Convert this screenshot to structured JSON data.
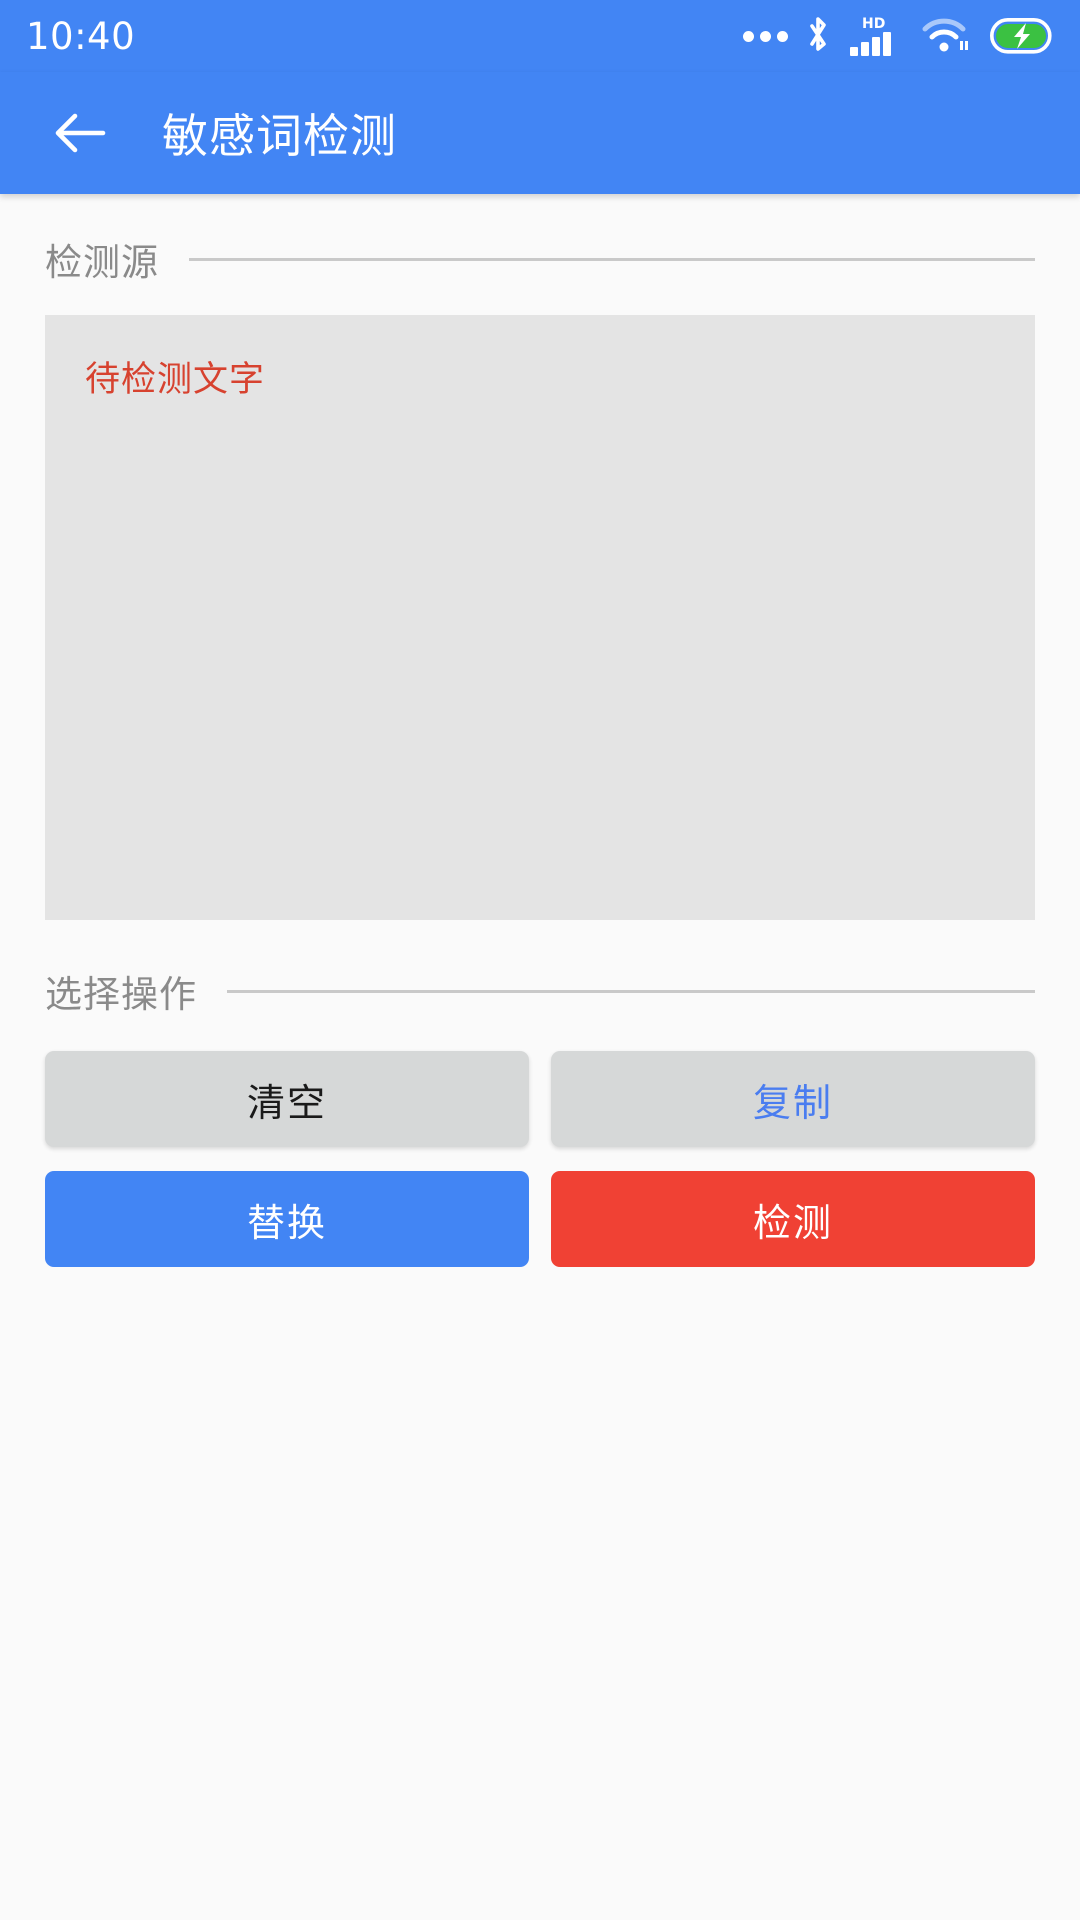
{
  "status_bar": {
    "time": "10:40",
    "icons": [
      {
        "name": "more-notifications-icon",
        "glyph": "dots"
      },
      {
        "name": "bluetooth-icon",
        "glyph": "bluetooth"
      },
      {
        "name": "hd-signal-icon",
        "glyph": "hd-bars",
        "label": "HD"
      },
      {
        "name": "wifi-icon",
        "glyph": "wifi"
      },
      {
        "name": "battery-charging-icon",
        "glyph": "battery-bolt"
      }
    ]
  },
  "app_bar": {
    "back_label": "←",
    "title": "敏感词检测"
  },
  "source_section": {
    "heading": "检测源",
    "placeholder": "待检测文字",
    "value": ""
  },
  "ops_section": {
    "heading": "选择操作",
    "buttons": [
      {
        "label": "清空",
        "style": "grey-dark"
      },
      {
        "label": "复制",
        "style": "grey-blue"
      },
      {
        "label": "替换",
        "style": "blue"
      },
      {
        "label": "检测",
        "style": "red"
      }
    ]
  },
  "colors": {
    "primary_blue": "#4285F4",
    "danger_red": "#F04134",
    "placeholder_red": "#D7422F",
    "grey_button": "#D6D8D8",
    "page_background": "#FAFAFA",
    "textarea_background": "#E4E4E4",
    "label_grey": "#8A8A8A",
    "rule_grey": "#C9C9C9",
    "battery_green": "#3BC142"
  }
}
